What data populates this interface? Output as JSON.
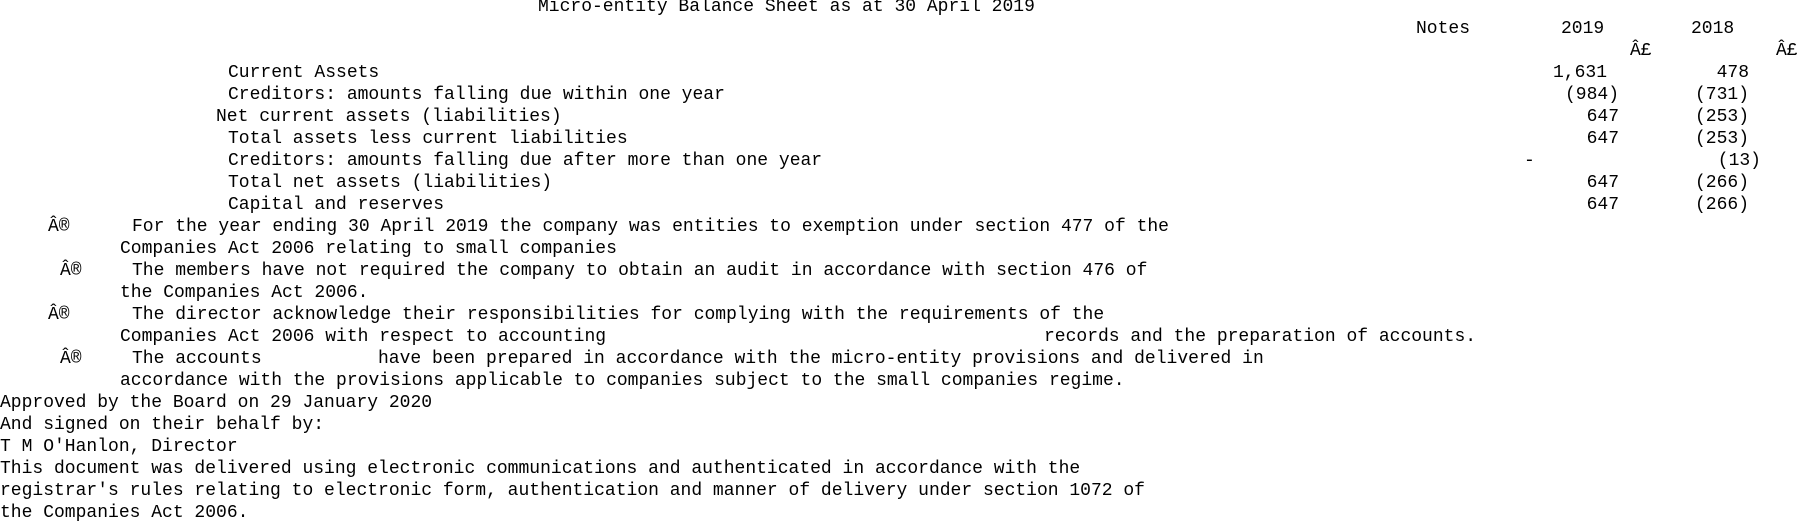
{
  "title": "Micro-entity Balance Sheet as at 30 April 2019",
  "columns": {
    "notes": "Notes",
    "year_current": "2019",
    "year_prior": "2018",
    "currency_current": "Â£",
    "currency_prior": "Â£"
  },
  "rows": [
    {
      "label": "Current Assets",
      "notes": "",
      "v2019": "1,631",
      "v2018": "478"
    },
    {
      "label": "Creditors: amounts falling due within one year",
      "notes": "",
      "v2019": "(984)",
      "v2018": "(731)"
    },
    {
      "label": "Net current assets (liabilities)",
      "notes": "",
      "v2019": "647",
      "v2018": "(253)"
    },
    {
      "label": "Total assets less current liabilities",
      "notes": "",
      "v2019": "647",
      "v2018": "(253)"
    },
    {
      "label": "Creditors: amounts falling due after more than one year",
      "notes": "-",
      "v2019": "",
      "v2018": "(13)"
    },
    {
      "label": "Total net assets (liabilities)",
      "notes": "",
      "v2019": "647",
      "v2018": "(266)"
    },
    {
      "label": "Capital and reserves",
      "notes": "",
      "v2019": "647",
      "v2018": "(266)"
    }
  ],
  "statements": [
    {
      "bullet": "Â®",
      "line1": "For the year ending 30 April 2019 the company was entities to exemption under section 477 of the",
      "line2": "Companies Act 2006 relating to small companies"
    },
    {
      "bullet": "Â®",
      "line1": "The members have not required the company to obtain an audit in accordance with section 476 of",
      "line2": "the Companies Act 2006."
    },
    {
      "bullet": "Â®",
      "line1": "The director acknowledge their responsibilities for complying with the requirements of the",
      "line2a": "Companies Act 2006 with respect to accounting",
      "line2b": "records and the preparation of accounts."
    },
    {
      "bullet": "Â®",
      "line1a": "The accounts",
      "line1b": "have been prepared in accordance with the micro-entity provisions and delivered in",
      "line2": "accordance with the provisions applicable to companies subject to the small companies regime."
    }
  ],
  "approval": {
    "approved": "Approved by the Board on 29 January 2020",
    "signed": "And signed on their behalf by:",
    "signatory": "T M O'Hanlon, Director"
  },
  "footer": [
    "This document was delivered using electronic communications and authenticated in accordance with the",
    "registrar's rules relating to electronic form, authentication and manner of delivery under section 1072 of",
    "the Companies Act 2006."
  ]
}
